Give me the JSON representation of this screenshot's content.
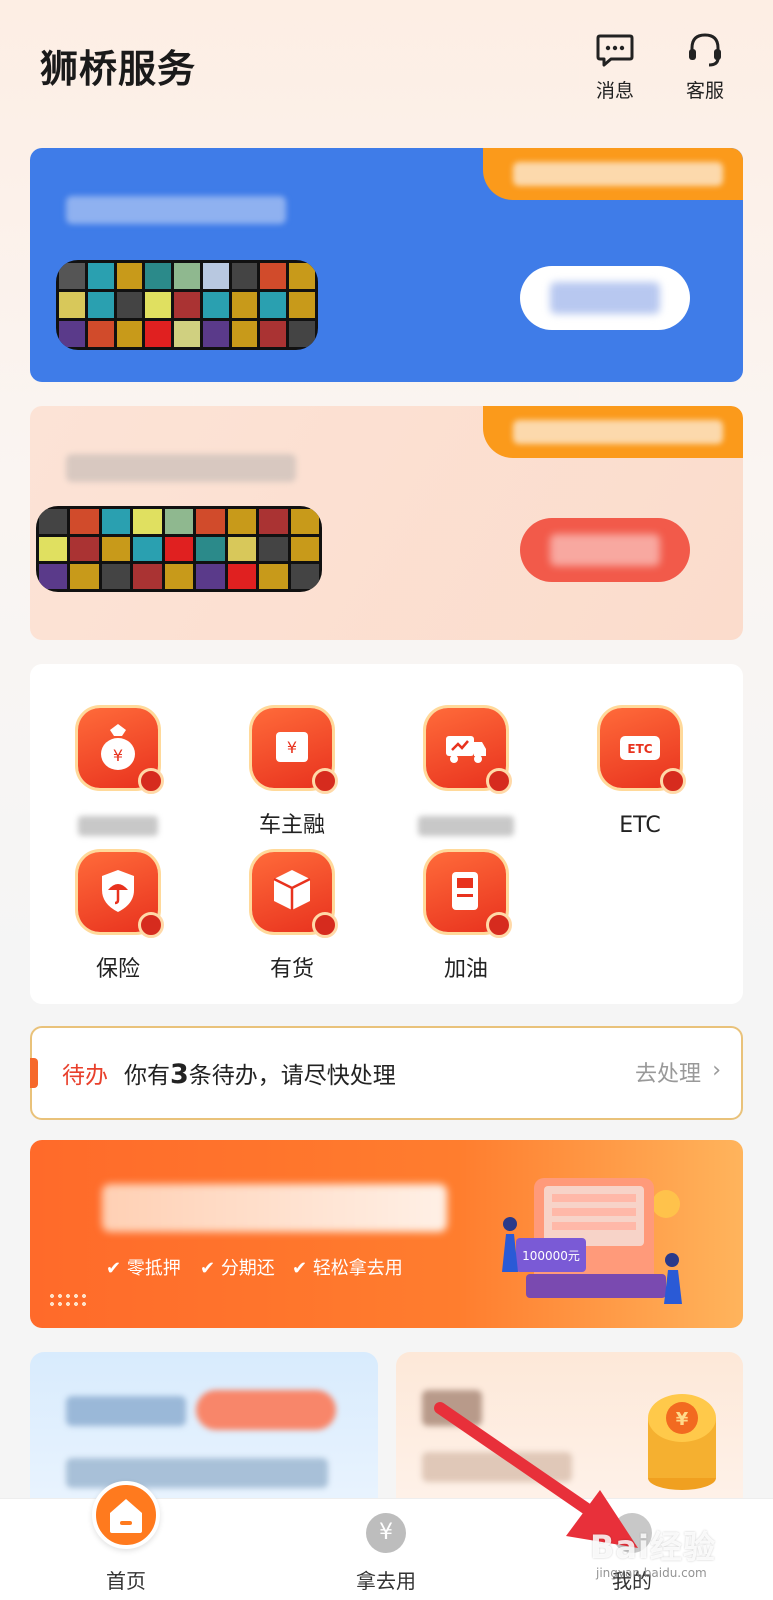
{
  "header": {
    "title": "狮桥服务",
    "messages_label": "消息",
    "service_label": "客服"
  },
  "services": [
    {
      "label": "",
      "icon": "money-bag-icon",
      "blurred": true
    },
    {
      "label": "车主融",
      "icon": "yuan-box-icon",
      "blurred": false
    },
    {
      "label": "",
      "icon": "truck-icon",
      "blurred": true
    },
    {
      "label": "ETC",
      "icon": "etc-icon",
      "blurred": false
    },
    {
      "label": "保险",
      "icon": "umbrella-shield-icon",
      "blurred": false
    },
    {
      "label": "有货",
      "icon": "cargo-box-icon",
      "blurred": false
    },
    {
      "label": "加油",
      "icon": "fuel-pump-icon",
      "blurred": false
    }
  ],
  "todo": {
    "tag": "待办",
    "prefix": "你有",
    "count": "3",
    "suffix": "条待办，请尽快处理",
    "action": "去处理"
  },
  "promo": {
    "features": [
      "零抵押",
      "分期还",
      "轻松拿去用"
    ],
    "machine_label": "100000元"
  },
  "tabbar": {
    "tabs": [
      {
        "label": "首页",
        "active": true
      },
      {
        "label": "拿去用",
        "active": false
      },
      {
        "label": "我的",
        "active": false
      }
    ]
  },
  "watermark": {
    "text": "Bai经验",
    "url": "jingyan.baidu.com"
  },
  "colors": {
    "accent": "#ff7a1e",
    "blue_card": "#3f7ce8",
    "tag_orange": "#fb9a1b",
    "todo_red": "#e8402c"
  }
}
